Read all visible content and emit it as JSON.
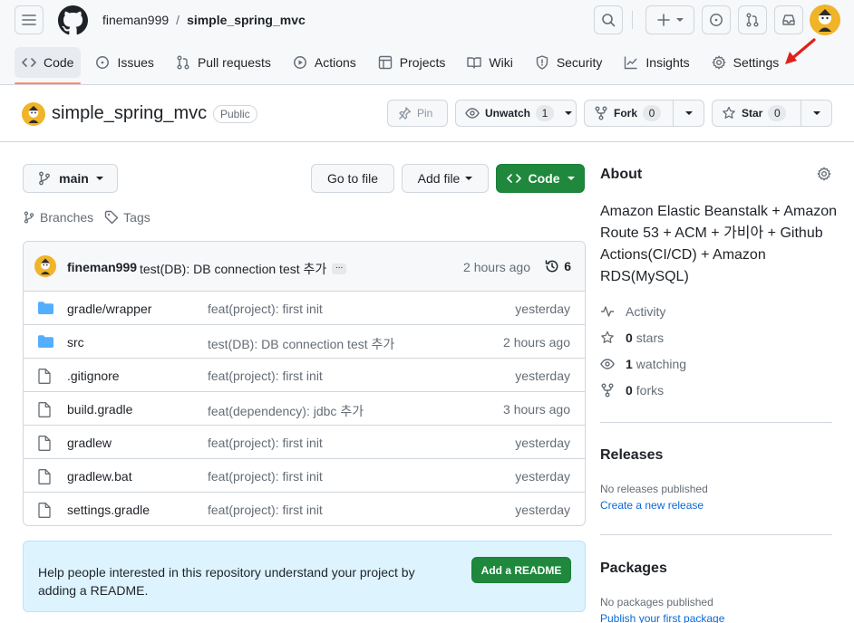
{
  "header": {
    "owner": "fineman999",
    "separator": "/",
    "repo": "simple_spring_mvc"
  },
  "tabs": [
    {
      "label": "Code",
      "icon": "code-icon"
    },
    {
      "label": "Issues",
      "icon": "issue-icon"
    },
    {
      "label": "Pull requests",
      "icon": "pull-request-icon"
    },
    {
      "label": "Actions",
      "icon": "play-icon"
    },
    {
      "label": "Projects",
      "icon": "table-icon"
    },
    {
      "label": "Wiki",
      "icon": "book-icon"
    },
    {
      "label": "Security",
      "icon": "shield-icon"
    },
    {
      "label": "Insights",
      "icon": "graph-icon"
    },
    {
      "label": "Settings",
      "icon": "gear-icon"
    }
  ],
  "repo": {
    "name": "simple_spring_mvc",
    "visibility": "Public",
    "pin_label": "Pin",
    "watch_label": "Unwatch",
    "watch_count": "1",
    "fork_label": "Fork",
    "fork_count": "0",
    "star_label": "Star",
    "star_count": "0"
  },
  "toolbar": {
    "branch": "main",
    "go_to_file": "Go to file",
    "add_file": "Add file",
    "code": "Code",
    "branches": "Branches",
    "tags": "Tags"
  },
  "commit": {
    "author": "fineman999",
    "message": "test(DB): DB connection test 추가",
    "ellipsis": "...",
    "time": "2 hours ago",
    "count": "6"
  },
  "files": [
    {
      "name": "gradle/wrapper",
      "type": "folder",
      "message": "feat(project): first init",
      "time": "yesterday"
    },
    {
      "name": "src",
      "type": "folder",
      "message": "test(DB): DB connection test 추가",
      "time": "2 hours ago"
    },
    {
      "name": ".gitignore",
      "type": "file",
      "message": "feat(project): first init",
      "time": "yesterday"
    },
    {
      "name": "build.gradle",
      "type": "file",
      "message": "feat(dependency): jdbc 추가",
      "time": "3 hours ago"
    },
    {
      "name": "gradlew",
      "type": "file",
      "message": "feat(project): first init",
      "time": "yesterday"
    },
    {
      "name": "gradlew.bat",
      "type": "file",
      "message": "feat(project): first init",
      "time": "yesterday"
    },
    {
      "name": "settings.gradle",
      "type": "file",
      "message": "feat(project): first init",
      "time": "yesterday"
    }
  ],
  "readme_banner": {
    "text": "Help people interested in this repository understand your project by adding a README.",
    "button": "Add a README"
  },
  "about": {
    "title": "About",
    "description": "Amazon Elastic Beanstalk + Amazon Route 53 + ACM + 가비아 + Github Actions(CI/CD) + Amazon RDS(MySQL)",
    "activity": "Activity",
    "stars_count": "0",
    "stars_label": "stars",
    "watching_count": "1",
    "watching_label": "watching",
    "forks_count": "0",
    "forks_label": "forks"
  },
  "releases": {
    "title": "Releases",
    "empty": "No releases published",
    "link": "Create a new release"
  },
  "packages": {
    "title": "Packages",
    "empty": "No packages published",
    "link": "Publish your first package"
  },
  "colors": {
    "accent_green": "#1f883d",
    "link_blue": "#0969da",
    "active_tab_underline": "#fd8c73",
    "annotation_arrow": "#e0201a",
    "folder_blue": "#54aeff"
  }
}
